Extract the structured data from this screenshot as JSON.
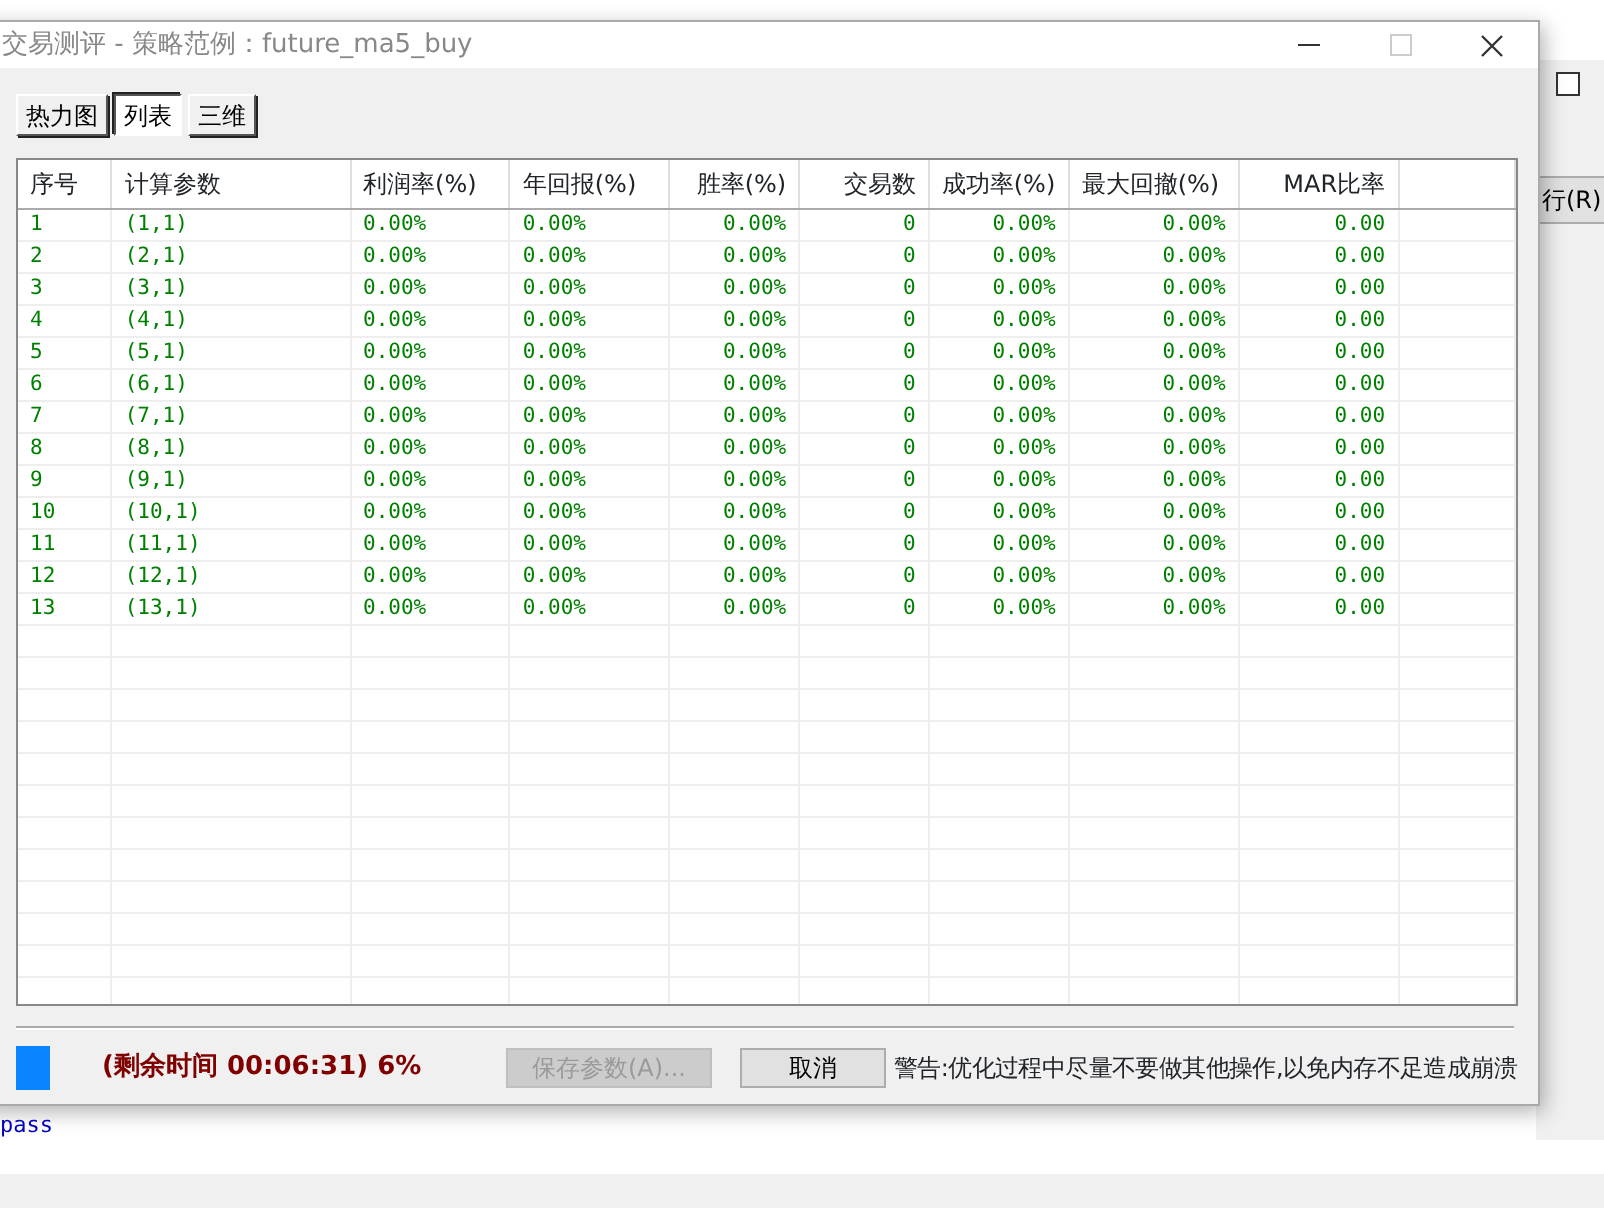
{
  "window": {
    "title": "交易测评 - 策略范例：future_ma5_buy"
  },
  "tabs": [
    {
      "label": "热力图",
      "selected": false
    },
    {
      "label": "列表",
      "selected": true
    },
    {
      "label": "三维",
      "selected": false
    }
  ],
  "table": {
    "columns": [
      "序号",
      "计算参数",
      "利润率(%)",
      "年回报(%)",
      "胜率(%)",
      "交易数",
      "成功率(%)",
      "最大回撤(%)",
      "MAR比率"
    ],
    "rows": [
      [
        "1",
        "(1,1)",
        "0.00%",
        "0.00%",
        "0.00%",
        "0",
        "0.00%",
        "0.00%",
        "0.00"
      ],
      [
        "2",
        "(2,1)",
        "0.00%",
        "0.00%",
        "0.00%",
        "0",
        "0.00%",
        "0.00%",
        "0.00"
      ],
      [
        "3",
        "(3,1)",
        "0.00%",
        "0.00%",
        "0.00%",
        "0",
        "0.00%",
        "0.00%",
        "0.00"
      ],
      [
        "4",
        "(4,1)",
        "0.00%",
        "0.00%",
        "0.00%",
        "0",
        "0.00%",
        "0.00%",
        "0.00"
      ],
      [
        "5",
        "(5,1)",
        "0.00%",
        "0.00%",
        "0.00%",
        "0",
        "0.00%",
        "0.00%",
        "0.00"
      ],
      [
        "6",
        "(6,1)",
        "0.00%",
        "0.00%",
        "0.00%",
        "0",
        "0.00%",
        "0.00%",
        "0.00"
      ],
      [
        "7",
        "(7,1)",
        "0.00%",
        "0.00%",
        "0.00%",
        "0",
        "0.00%",
        "0.00%",
        "0.00"
      ],
      [
        "8",
        "(8,1)",
        "0.00%",
        "0.00%",
        "0.00%",
        "0",
        "0.00%",
        "0.00%",
        "0.00"
      ],
      [
        "9",
        "(9,1)",
        "0.00%",
        "0.00%",
        "0.00%",
        "0",
        "0.00%",
        "0.00%",
        "0.00"
      ],
      [
        "10",
        "(10,1)",
        "0.00%",
        "0.00%",
        "0.00%",
        "0",
        "0.00%",
        "0.00%",
        "0.00"
      ],
      [
        "11",
        "(11,1)",
        "0.00%",
        "0.00%",
        "0.00%",
        "0",
        "0.00%",
        "0.00%",
        "0.00"
      ],
      [
        "12",
        "(12,1)",
        "0.00%",
        "0.00%",
        "0.00%",
        "0",
        "0.00%",
        "0.00%",
        "0.00"
      ],
      [
        "13",
        "(13,1)",
        "0.00%",
        "0.00%",
        "0.00%",
        "0",
        "0.00%",
        "0.00%",
        "0.00"
      ]
    ]
  },
  "footer": {
    "remaining": "(剩余时间 00:06:31) 6%",
    "save_button": {
      "label": "保存参数(A)...",
      "disabled": true
    },
    "cancel_button": {
      "label": "取消",
      "disabled": false
    },
    "warning": "警告:优化过程中尽量不要做其他操作,以免内存不足造成崩溃"
  },
  "background": {
    "checkbox_checked": false,
    "button": "行(R)",
    "console": "pass"
  }
}
